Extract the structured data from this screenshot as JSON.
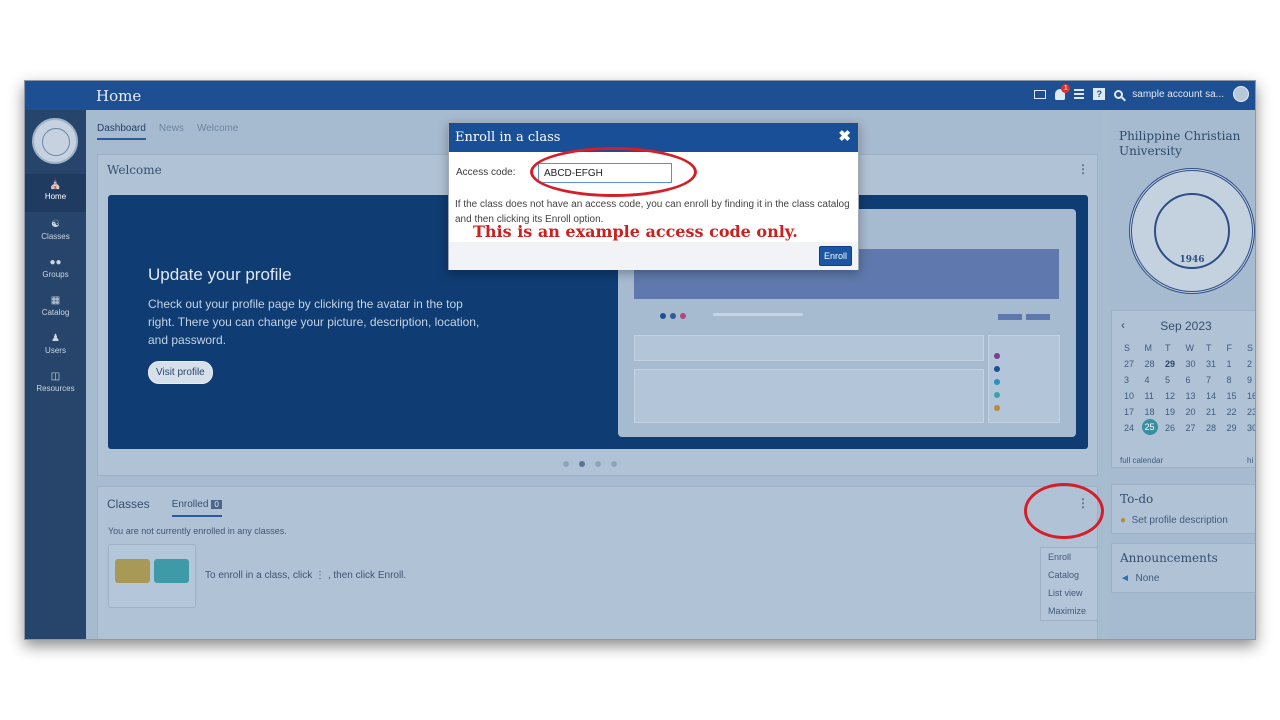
{
  "topbar": {
    "title": "Home",
    "notification_count": "1",
    "user_name": "sample account sa..."
  },
  "nav": [
    {
      "label": "Home",
      "icon": "home-icon"
    },
    {
      "label": "Classes",
      "icon": "classes-icon"
    },
    {
      "label": "Groups",
      "icon": "groups-icon"
    },
    {
      "label": "Catalog",
      "icon": "catalog-icon"
    },
    {
      "label": "Users",
      "icon": "users-icon"
    },
    {
      "label": "Resources",
      "icon": "resources-icon"
    }
  ],
  "tabs": [
    "Dashboard",
    "News",
    "Welcome"
  ],
  "welcome": {
    "title": "Welcome",
    "banner_heading": "Update your profile",
    "banner_text": "Check out your profile page by clicking the avatar in the top right. There you can change your picture, description, location, and password.",
    "visit_button": "Visit profile"
  },
  "classes": {
    "title": "Classes",
    "enrolled_tab": "Enrolled",
    "enrolled_count": "0",
    "empty_text": "You are not currently enrolled in any classes.",
    "hint": "To enroll in a class, click ⋮ , then click Enroll.",
    "menu": [
      "Enroll",
      "Catalog",
      "List view",
      "Maximize"
    ]
  },
  "right": {
    "university": "Philippine Christian University",
    "seal_year": "1946",
    "calendar": {
      "month": "Sep 2023",
      "weekdays": [
        "S",
        "M",
        "T",
        "W",
        "T",
        "F",
        "S"
      ],
      "weeks": [
        [
          "27",
          "28",
          "29",
          "30",
          "31",
          "1",
          "2"
        ],
        [
          "3",
          "4",
          "5",
          "6",
          "7",
          "8",
          "9"
        ],
        [
          "10",
          "11",
          "12",
          "13",
          "14",
          "15",
          "16"
        ],
        [
          "17",
          "18",
          "19",
          "20",
          "21",
          "22",
          "23"
        ],
        [
          "24",
          "25",
          "26",
          "27",
          "28",
          "29",
          "30"
        ]
      ],
      "today": "25",
      "full_link": "full calendar",
      "hide_link": "hi"
    },
    "todo": {
      "title": "To-do",
      "item": "Set profile description"
    },
    "announcements": {
      "title": "Announcements",
      "item": "None"
    }
  },
  "modal": {
    "title": "Enroll in a class",
    "close": "✖",
    "code_label": "Access code:",
    "code_value": "ABCD-EFGH",
    "info": "If the class does not have an access code, you can enroll by finding it in the class catalog and then clicking its Enroll option.",
    "enroll_button": "Enroll"
  },
  "annotation": "This is an example access code only.",
  "colors": {
    "accent": "#1f4f93",
    "annotation": "#cc1f1f",
    "today": "#3a8ea0"
  }
}
